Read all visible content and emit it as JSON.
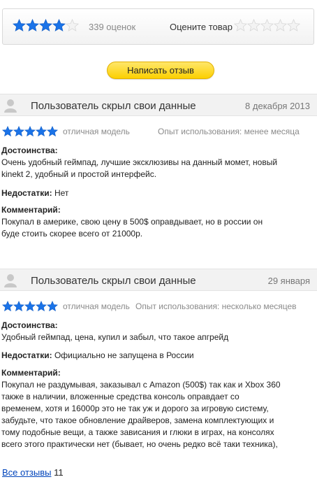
{
  "rating": {
    "average_stars": 4,
    "count_text": "339 оценок",
    "rate_label": "Оцените товар",
    "rate_stars": 5
  },
  "colors": {
    "star_blue": "#1a73e8",
    "star_empty": "#d6d6d6",
    "button_yellow": "#fcd000",
    "link": "#0044bb"
  },
  "write_button": "Написать отзыв",
  "reviews": [
    {
      "author": "Пользователь скрыл свои данные",
      "date": "8 декабря 2013",
      "stars": 5,
      "verdict": "отличная модель",
      "usage": "Опыт использования: менее месяца",
      "pros_label": "Достоинства:",
      "pros_lines": [
        "Очень удобный геймпад, лучшие эксклюзивы на данный момет, новый",
        "kinekt 2, удобный и простой интерфейс."
      ],
      "cons_label": "Недостатки:",
      "cons": "Нет",
      "comment_label": "Комментарий:",
      "comment_lines": [
        "Покупал в америке, свою цену в 500$ оправдывает, но в россии он",
        "буде стоить скорее всего от 21000р."
      ]
    },
    {
      "author": "Пользователь скрыл свои данные",
      "date": "29 января",
      "stars": 5,
      "verdict": "отличная модель",
      "usage": "Опыт использования: несколько месяцев",
      "pros_label": "Достоинства:",
      "pros_lines": [
        "Удобный геймпад, цена, купил и забыл, что такое апгрейд"
      ],
      "cons_label": "Недостатки:",
      "cons": "Официально не запущена в России",
      "comment_label": "Комментарий:",
      "comment_lines": [
        "Покупал не раздумывая, заказывал с Amazon (500$) так как и Xbox 360",
        "также в наличии, вложенные средства консоль оправдает со",
        "временем, хотя и 16000р это не так уж и дорого за игровую систему,",
        "забудьте, что такое обновление драйверов, замена комплектующих и",
        "тому подобные вещи, а также зависания и глюки в играх, на консолях",
        "всего этого практически нет (бывает, но очень редко всё таки техника),"
      ]
    }
  ],
  "footer": {
    "all_reviews_label": "Все отзывы",
    "all_reviews_count": "11"
  }
}
